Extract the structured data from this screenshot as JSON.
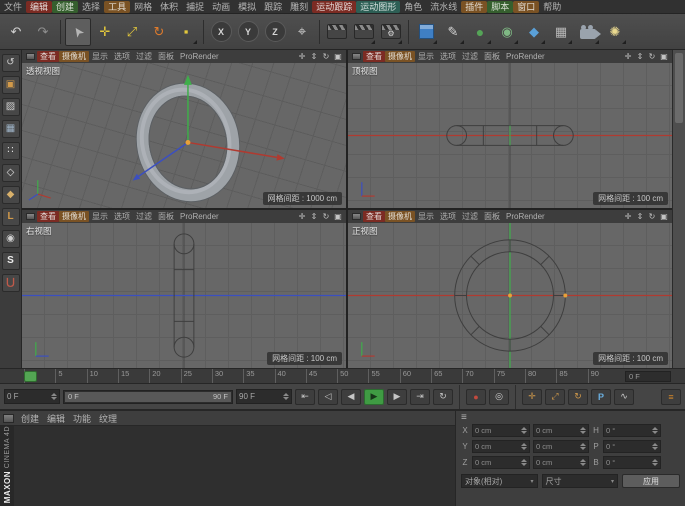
{
  "menubar": {
    "items": [
      {
        "label": "文件",
        "style": ""
      },
      {
        "label": "编辑",
        "style": "background:#7c2b23;color:#e2d8d6;border-radius:2px"
      },
      {
        "label": "创建",
        "style": "background:#355f2e;color:#dae1d6;border-radius:2px"
      },
      {
        "label": "选择",
        "style": ""
      },
      {
        "label": "工具",
        "style": "background:#7a5224;color:#e1dbd1;border-radius:2px"
      },
      {
        "label": "网格",
        "style": ""
      },
      {
        "label": "体积",
        "style": ""
      },
      {
        "label": "捕捉",
        "style": ""
      },
      {
        "label": "动画",
        "style": ""
      },
      {
        "label": "模拟",
        "style": ""
      },
      {
        "label": "跟踪",
        "style": ""
      },
      {
        "label": "雕刻",
        "style": ""
      },
      {
        "label": "运动跟踪",
        "style": "background:#7c2b23;color:#e2d8d6;border-radius:2px"
      },
      {
        "label": "运动图形",
        "style": "background:#2d5f55;color:#d6e1de;border-radius:2px"
      },
      {
        "label": "角色",
        "style": ""
      },
      {
        "label": "流水线",
        "style": ""
      },
      {
        "label": "插件",
        "style": "background:#7a5224;color:#e1dbd1;border-radius:2px"
      },
      {
        "label": "脚本",
        "style": "background:#355f2e;color:#dae1d6;border-radius:2px"
      },
      {
        "label": "窗口",
        "style": "background:#7a5224;color:#e1dbd1;border-radius:2px"
      },
      {
        "label": "帮助",
        "style": ""
      }
    ]
  },
  "toolbar": {
    "buttons": [
      {
        "name": "undo",
        "glyph": "↶",
        "style": "color:#d0d0d0"
      },
      {
        "name": "redo",
        "glyph": "↷",
        "style": "color:#8f8f8f"
      },
      {
        "name": "live-selection",
        "glyph": "➤",
        "style": "color:#ececec"
      },
      {
        "name": "move",
        "glyph": "✛",
        "style": "color:#e3c83c"
      },
      {
        "name": "scale",
        "glyph": "⤢",
        "style": "color:#e3c83c"
      },
      {
        "name": "rotate",
        "glyph": "↻",
        "style": "color:#df7b2c"
      },
      {
        "name": "last-tool",
        "glyph": "▪",
        "style": "color:#e3c83c"
      },
      {
        "name": "lock-x",
        "glyph": "X",
        "style": ""
      },
      {
        "name": "lock-y",
        "glyph": "Y",
        "style": ""
      },
      {
        "name": "lock-z",
        "glyph": "Z",
        "style": ""
      },
      {
        "name": "coord-system",
        "glyph": "⌖",
        "style": "color:#cfcfcf;font-size:15px"
      },
      {
        "name": "render-view",
        "glyph": "",
        "style": ""
      },
      {
        "name": "render-picture-viewer",
        "glyph": "",
        "style": ""
      },
      {
        "name": "render-settings",
        "glyph": "⚙",
        "style": "color:#d8d8d8"
      },
      {
        "name": "add-cube",
        "glyph": "",
        "style": ""
      },
      {
        "name": "spline-pen",
        "glyph": "✎",
        "style": "color:#d8d8d8"
      },
      {
        "name": "subdivision-surface",
        "glyph": "●",
        "style": "color:#55a457;font-size:14px"
      },
      {
        "name": "generators",
        "glyph": "◉",
        "style": "color:#7fb984"
      },
      {
        "name": "deformers",
        "glyph": "◆",
        "style": "color:#5aa0d8"
      },
      {
        "name": "environment",
        "glyph": "▦",
        "style": "color:#b8b8b8"
      },
      {
        "name": "camera",
        "glyph": "",
        "style": ""
      },
      {
        "name": "light",
        "glyph": "✺",
        "style": "color:#ead98f"
      }
    ]
  },
  "left_toolbar": {
    "buttons": [
      {
        "name": "make-editable",
        "glyph": "↺",
        "style": "color:#cfcfcf"
      },
      {
        "name": "model-mode",
        "glyph": "▣",
        "style": "color:#d29a4a"
      },
      {
        "name": "texture-mode",
        "glyph": "▨",
        "style": "color:#cfcfcf"
      },
      {
        "name": "workplane-mode",
        "glyph": "▦",
        "style": "color:#9fb4c8"
      },
      {
        "name": "points-mode",
        "glyph": "∷",
        "style": "color:#e0e0e0"
      },
      {
        "name": "edges-mode",
        "glyph": "◇",
        "style": "color:#e0e0e0"
      },
      {
        "name": "polygons-mode",
        "glyph": "◆",
        "style": "color:#d8b06a"
      },
      {
        "name": "axis-mode",
        "glyph": "L",
        "style": "color:#d29a4a;font-weight:bold"
      },
      {
        "name": "solo-mode",
        "glyph": "◉",
        "style": "color:#cfcfcf"
      },
      {
        "name": "snap",
        "glyph": "S",
        "style": "color:#ececec;font-weight:bold"
      },
      {
        "name": "quantize-magnet",
        "glyph": "⋃",
        "style": "color:#c05a4a;font-weight:bold"
      }
    ]
  },
  "viewports": {
    "menu": [
      "查看",
      "摄像机",
      "显示",
      "选项",
      "过滤",
      "面板",
      "ProRender"
    ],
    "menu_styles": [
      "background:#7c2b23;color:#e2d8d6",
      "background:#7a5224;color:#e1dbd1",
      "",
      "",
      "",
      "",
      ""
    ],
    "icons": [
      "✛",
      "⇕",
      "↻",
      "▣"
    ],
    "perspective": {
      "label": "透视视图",
      "grid_spacing": "网格间距 : 1000 cm"
    },
    "top": {
      "label": "顶视图",
      "grid_spacing": "网格间距 : 100 cm"
    },
    "right": {
      "label": "右视图",
      "grid_spacing": "网格间距 : 100 cm"
    },
    "front": {
      "label": "正视图",
      "grid_spacing": "网格间距 : 100 cm"
    }
  },
  "timeline": {
    "ticks": [
      "0",
      "5",
      "10",
      "15",
      "20",
      "25",
      "30",
      "35",
      "40",
      "45",
      "50",
      "55",
      "60",
      "65",
      "70",
      "75",
      "80",
      "85",
      "90"
    ],
    "frame_display": "0 F"
  },
  "transport": {
    "current_frame": "0 F",
    "range_start": "0 F",
    "range_end": "90 F",
    "end_frame": "90 F",
    "buttons": [
      {
        "name": "goto-start",
        "glyph": "⇤"
      },
      {
        "name": "prev-key",
        "glyph": "◁"
      },
      {
        "name": "prev-frame",
        "glyph": "◀"
      },
      {
        "name": "play",
        "glyph": "▶"
      },
      {
        "name": "next-frame",
        "glyph": "▶"
      },
      {
        "name": "goto-end",
        "glyph": "⇥"
      },
      {
        "name": "loop",
        "glyph": "↻"
      }
    ],
    "record": [
      {
        "name": "record-keyframe",
        "glyph": "●",
        "style": "color:#c24a3e"
      },
      {
        "name": "autokey",
        "glyph": "◎",
        "style": "color:#cfcfcf"
      }
    ],
    "toggles": [
      {
        "name": "record-position",
        "glyph": "✛",
        "style": "color:#d29a4a"
      },
      {
        "name": "record-scale",
        "glyph": "⤢",
        "style": "color:#d29a4a"
      },
      {
        "name": "record-rotation",
        "glyph": "↻",
        "style": "color:#d29a4a"
      },
      {
        "name": "record-parameter",
        "glyph": "P",
        "style": "color:#6aaede;font-weight:bold"
      },
      {
        "name": "record-pla",
        "glyph": "∿",
        "style": "color:#cfcfcf"
      }
    ],
    "menu_icon": "≡"
  },
  "materials": {
    "menu": [
      "创建",
      "编辑",
      "功能",
      "纹理"
    ]
  },
  "coordinates": {
    "menu_icon": "≡",
    "dropdown_arrow": "▾",
    "rows": [
      {
        "axis": "X",
        "pos": "0 cm",
        "size": "0 cm",
        "rot_axis": "H",
        "rot": "0 °"
      },
      {
        "axis": "Y",
        "pos": "0 cm",
        "size": "0 cm",
        "rot_axis": "P",
        "rot": "0 °"
      },
      {
        "axis": "Z",
        "pos": "0 cm",
        "size": "0 cm",
        "rot_axis": "B",
        "rot": "0 °"
      }
    ],
    "transform_dropdown": "对象(相对)",
    "size_dropdown": "尺寸",
    "apply_label": "应用"
  },
  "logo": {
    "brand": "MAXON ",
    "product": "CINEMA 4D"
  },
  "colors": {
    "accent_green": "#3f9b43",
    "axis_x": "#b03a30",
    "axis_y": "#3fae4a",
    "axis_z": "#3b4fc0"
  }
}
